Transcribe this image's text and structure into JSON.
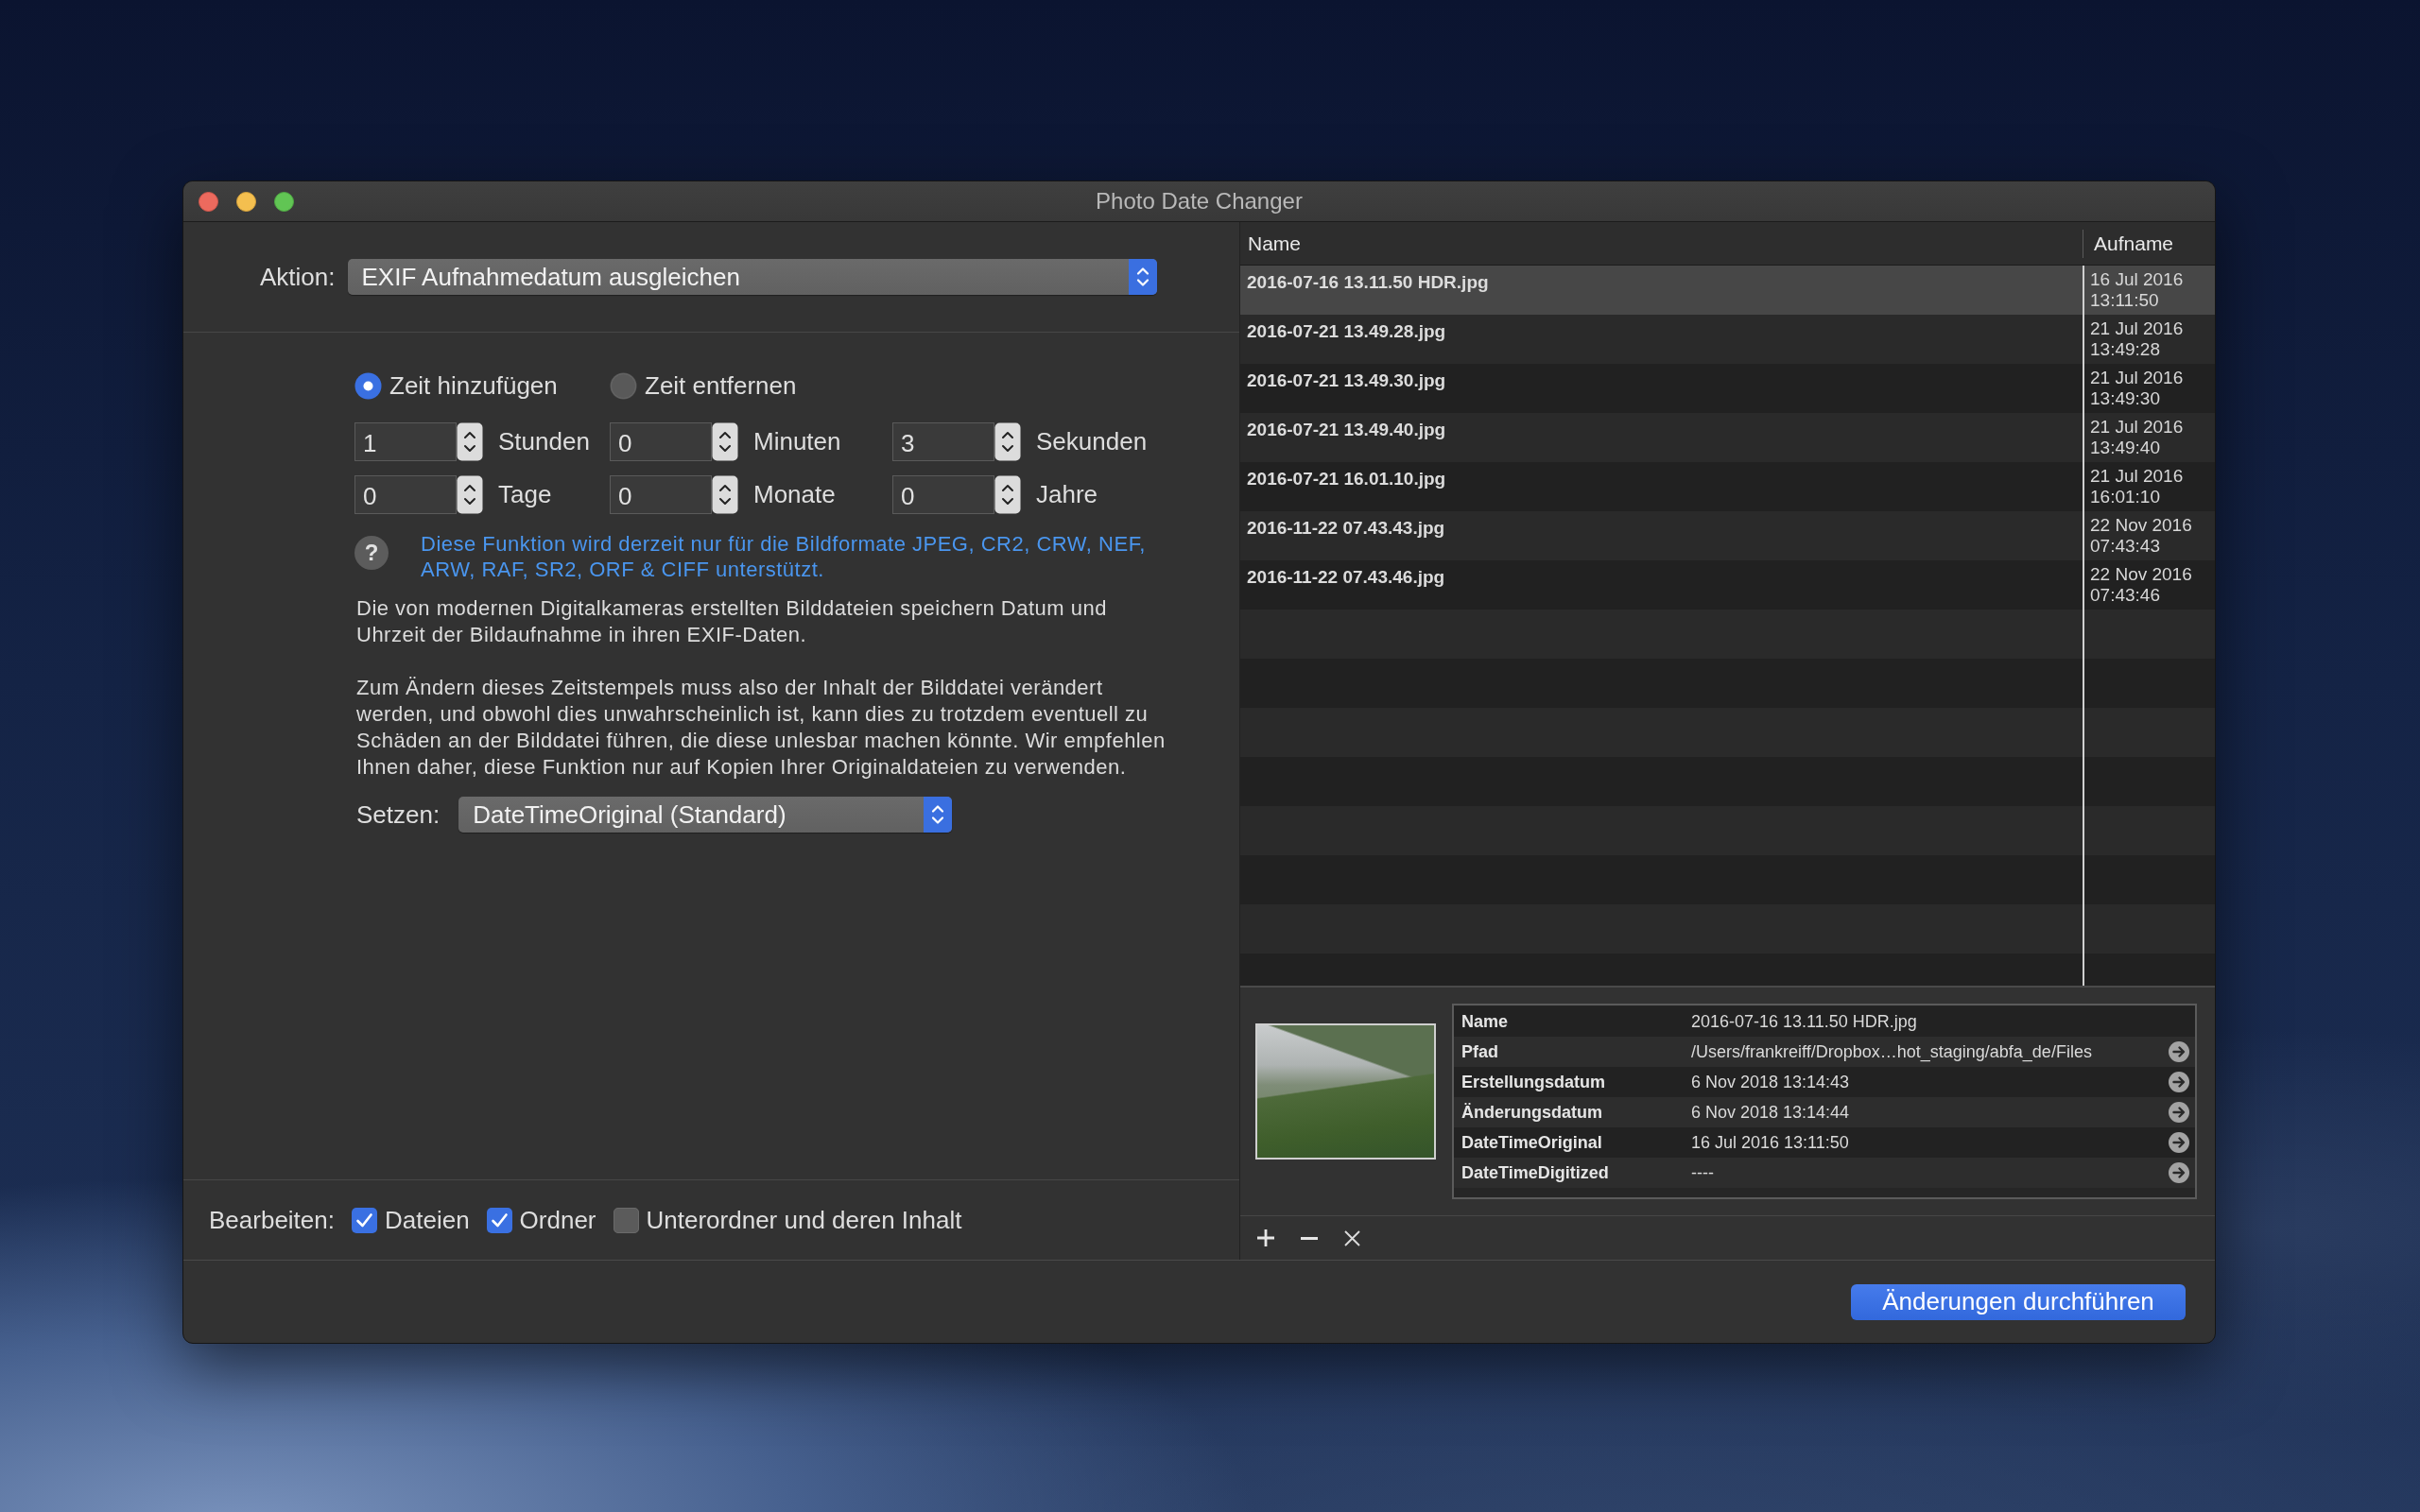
{
  "window": {
    "title": "Photo Date Changer"
  },
  "action": {
    "label": "Aktion:",
    "value": "EXIF Aufnahmedatum ausgleichen"
  },
  "mode": [
    {
      "label": "Zeit hinzufügen",
      "selected": true
    },
    {
      "label": "Zeit entfernen",
      "selected": false
    }
  ],
  "offsets": [
    {
      "value": "1",
      "unit": "Stunden"
    },
    {
      "value": "0",
      "unit": "Minuten"
    },
    {
      "value": "3",
      "unit": "Sekunden"
    },
    {
      "value": "0",
      "unit": "Tage"
    },
    {
      "value": "0",
      "unit": "Monate"
    },
    {
      "value": "0",
      "unit": "Jahre"
    }
  ],
  "help": {
    "button": "?",
    "note": "Diese Funktion wird derzeit nur für die Bildformate JPEG, CR2, CRW, NEF, ARW, RAF, SR2, ORF & CIFF unterstützt."
  },
  "description": [
    "Die von modernen Digitalkameras erstellten Bilddateien speichern Datum und Uhrzeit der Bildaufnahme in ihren EXIF-Daten.",
    "Zum Ändern dieses Zeitstempels muss also der Inhalt der Bilddatei verändert werden, und obwohl dies unwahrscheinlich ist, kann dies zu trotzdem eventuell zu Schäden an der Bilddatei führen, die diese unlesbar machen könnte. Wir empfehlen Ihnen daher, diese Funktion nur auf Kopien Ihrer Originaldateien zu verwenden."
  ],
  "set_field": {
    "label": "Setzen:",
    "value": "DateTimeOriginal (Standard)"
  },
  "edit": {
    "label": "Bearbeiten:",
    "options": [
      {
        "label": "Dateien",
        "checked": true
      },
      {
        "label": "Ordner",
        "checked": true
      },
      {
        "label": "Unterordner und deren Inhalt",
        "checked": false
      }
    ]
  },
  "file_table": {
    "columns": [
      "Name",
      "Aufname"
    ],
    "rows": [
      {
        "name": "2016-07-16 13.11.50 HDR.jpg",
        "date": "16 Jul 2016 13:11:50",
        "selected": true
      },
      {
        "name": "2016-07-21 13.49.28.jpg",
        "date": "21 Jul 2016 13:49:28",
        "selected": false
      },
      {
        "name": "2016-07-21 13.49.30.jpg",
        "date": "21 Jul 2016 13:49:30",
        "selected": false
      },
      {
        "name": "2016-07-21 13.49.40.jpg",
        "date": "21 Jul 2016 13:49:40",
        "selected": false
      },
      {
        "name": "2016-07-21 16.01.10.jpg",
        "date": "21 Jul 2016 16:01:10",
        "selected": false
      },
      {
        "name": "2016-11-22 07.43.43.jpg",
        "date": "22 Nov 2016 07:43:43",
        "selected": false
      },
      {
        "name": "2016-11-22 07.43.46.jpg",
        "date": "22 Nov 2016 07:43:46",
        "selected": false
      }
    ]
  },
  "details": [
    {
      "key": "Name",
      "value": "2016-07-16 13.11.50 HDR.jpg",
      "kind": "plain"
    },
    {
      "key": "Pfad",
      "value": "/Users/frankreiff/Dropbox…hot_staging/abfa_de/Files",
      "kind": "link"
    },
    {
      "key": "Erstellungsdatum",
      "value": "6 Nov 2018 13:14:43",
      "kind": "link"
    },
    {
      "key": "Änderungsdatum",
      "value": "6 Nov 2018 13:14:44",
      "kind": "link"
    },
    {
      "key": "DateTimeOriginal",
      "value": "16 Jul 2016 13:11:50",
      "kind": "link"
    },
    {
      "key": "DateTimeDigitized",
      "value": "----",
      "kind": "link"
    }
  ],
  "apply_button": "Änderungen durchführen"
}
